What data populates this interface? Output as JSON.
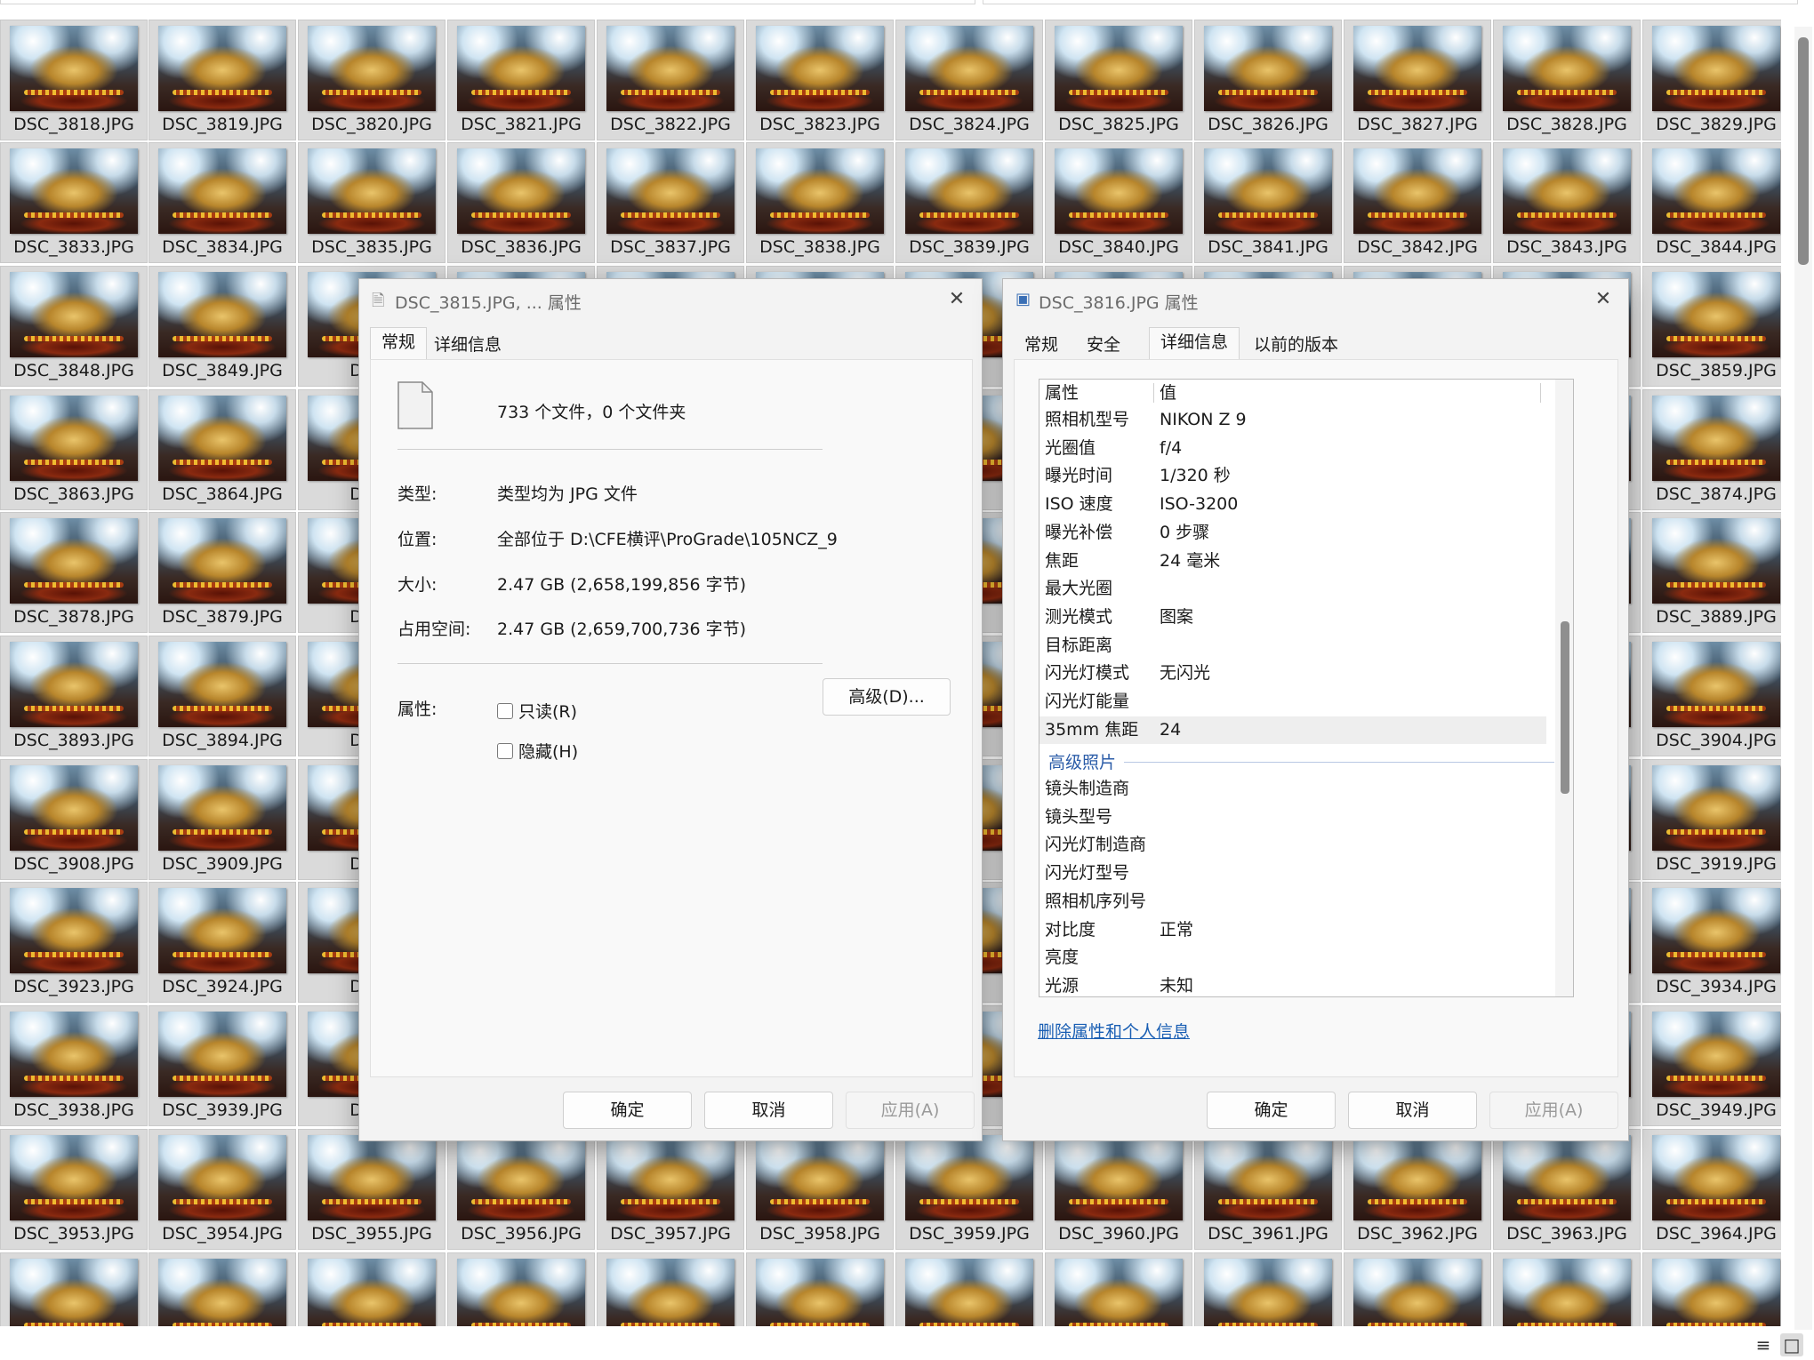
{
  "thumbnails": {
    "rows": [
      [
        "DSC_3818.JPG",
        "DSC_3819.JPG",
        "DSC_3820.JPG",
        "DSC_3821.JPG",
        "DSC_3822.JPG",
        "DSC_3823.JPG",
        "DSC_3824.JPG",
        "DSC_3825.JPG",
        "DSC_3826.JPG",
        "DSC_3827.JPG",
        "DSC_3828.JPG",
        "DSC_3829.JPG"
      ],
      [
        "DSC_3833.JPG",
        "DSC_3834.JPG",
        "DSC_3835.JPG",
        "DSC_3836.JPG",
        "DSC_3837.JPG",
        "DSC_3838.JPG",
        "DSC_3839.JPG",
        "DSC_3840.JPG",
        "DSC_3841.JPG",
        "DSC_3842.JPG",
        "DSC_3843.JPG",
        "DSC_3844.JPG"
      ],
      [
        "DSC_3848.JPG",
        "DSC_3849.JPG",
        "DSC_",
        "",
        "",
        "",
        "",
        "",
        "",
        "",
        "",
        "DSC_3859.JPG"
      ],
      [
        "DSC_3863.JPG",
        "DSC_3864.JPG",
        "DSC_",
        "",
        "",
        "",
        "",
        "",
        "",
        "",
        "",
        "DSC_3874.JPG"
      ],
      [
        "DSC_3878.JPG",
        "DSC_3879.JPG",
        "DSC_",
        "",
        "",
        "",
        "",
        "",
        "",
        "",
        "",
        "DSC_3889.JPG"
      ],
      [
        "DSC_3893.JPG",
        "DSC_3894.JPG",
        "DSC_",
        "",
        "",
        "",
        "",
        "",
        "",
        "",
        "",
        "DSC_3904.JPG"
      ],
      [
        "DSC_3908.JPG",
        "DSC_3909.JPG",
        "DSC_",
        "",
        "",
        "",
        "",
        "",
        "",
        "",
        "",
        "DSC_3919.JPG"
      ],
      [
        "DSC_3923.JPG",
        "DSC_3924.JPG",
        "DSC_",
        "",
        "",
        "",
        "",
        "",
        "",
        "",
        "",
        "DSC_3934.JPG"
      ],
      [
        "DSC_3938.JPG",
        "DSC_3939.JPG",
        "DSC_",
        "",
        "",
        "",
        "",
        "",
        "",
        "",
        "",
        "DSC_3949.JPG"
      ],
      [
        "DSC_3953.JPG",
        "DSC_3954.JPG",
        "DSC_3955.JPG",
        "DSC_3956.JPG",
        "DSC_3957.JPG",
        "DSC_3958.JPG",
        "DSC_3959.JPG",
        "DSC_3960.JPG",
        "DSC_3961.JPG",
        "DSC_3962.JPG",
        "DSC_3963.JPG",
        "DSC_3964.JPG"
      ],
      [
        "",
        "",
        "",
        "",
        "",
        "",
        "",
        "",
        "",
        "",
        "",
        ""
      ]
    ]
  },
  "dialog1": {
    "title": "DSC_3815.JPG, ... 属性",
    "tabs": [
      "常规",
      "详细信息"
    ],
    "summary": "733 个文件，0 个文件夹",
    "type_label": "类型:",
    "type_value": "类型均为 JPG 文件",
    "location_label": "位置:",
    "location_value": "全部位于 D:\\CFE横评\\ProGrade\\105NCZ_9",
    "size_label": "大小:",
    "size_value": "2.47 GB (2,658,199,856 字节)",
    "disk_label": "占用空间:",
    "disk_value": "2.47 GB (2,659,700,736 字节)",
    "attr_label": "属性:",
    "readonly_label": "只读(R)",
    "hidden_label": "隐藏(H)",
    "advanced_button": "高级(D)...",
    "ok_button": "确定",
    "cancel_button": "取消",
    "apply_button": "应用(A)"
  },
  "dialog2": {
    "title": "DSC_3816.JPG 属性",
    "tabs": [
      "常规",
      "安全",
      "详细信息",
      "以前的版本"
    ],
    "header_key": "属性",
    "header_value": "值",
    "rows": [
      {
        "k": "照相机型号",
        "v": "NIKON Z 9"
      },
      {
        "k": "光圈值",
        "v": "f/4"
      },
      {
        "k": "曝光时间",
        "v": "1/320 秒"
      },
      {
        "k": "ISO 速度",
        "v": "ISO-3200"
      },
      {
        "k": "曝光补偿",
        "v": "0 步骤"
      },
      {
        "k": "焦距",
        "v": "24 毫米"
      },
      {
        "k": "最大光圈",
        "v": ""
      },
      {
        "k": "测光模式",
        "v": "图案"
      },
      {
        "k": "目标距离",
        "v": ""
      },
      {
        "k": "闪光灯模式",
        "v": "无闪光"
      },
      {
        "k": "闪光灯能量",
        "v": ""
      },
      {
        "k": "35mm 焦距",
        "v": "24"
      }
    ],
    "group_label": "高级照片",
    "rows2": [
      {
        "k": "镜头制造商",
        "v": ""
      },
      {
        "k": "镜头型号",
        "v": ""
      },
      {
        "k": "闪光灯制造商",
        "v": ""
      },
      {
        "k": "闪光灯型号",
        "v": ""
      },
      {
        "k": "照相机序列号",
        "v": ""
      },
      {
        "k": "对比度",
        "v": "正常"
      },
      {
        "k": "亮度",
        "v": ""
      },
      {
        "k": "光源",
        "v": "未知"
      }
    ],
    "remove_link": "删除属性和个人信息",
    "ok_button": "确定",
    "cancel_button": "取消",
    "apply_button": "应用(A)"
  },
  "statusbar": {
    "icons": [
      "details-view-icon",
      "large-icons-view-icon"
    ]
  }
}
